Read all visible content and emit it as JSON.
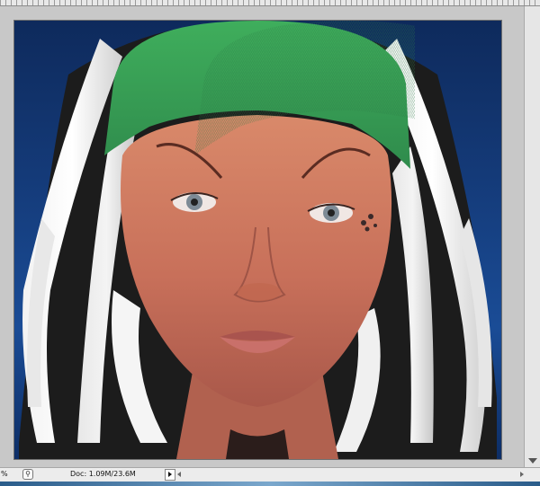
{
  "status_bar": {
    "zoom": "%",
    "doc_size": "Doc: 1.09M/23.6M"
  },
  "canvas": {
    "image_description_icon": "portrait-photo",
    "background_color": "#143a78"
  },
  "icons": {
    "zoom": "magnifier-icon",
    "doc_menu": "triangle-right-icon",
    "scroll_left": "arrow-left-icon",
    "scroll_right": "arrow-right-icon",
    "scroll_down": "arrow-down-icon"
  }
}
